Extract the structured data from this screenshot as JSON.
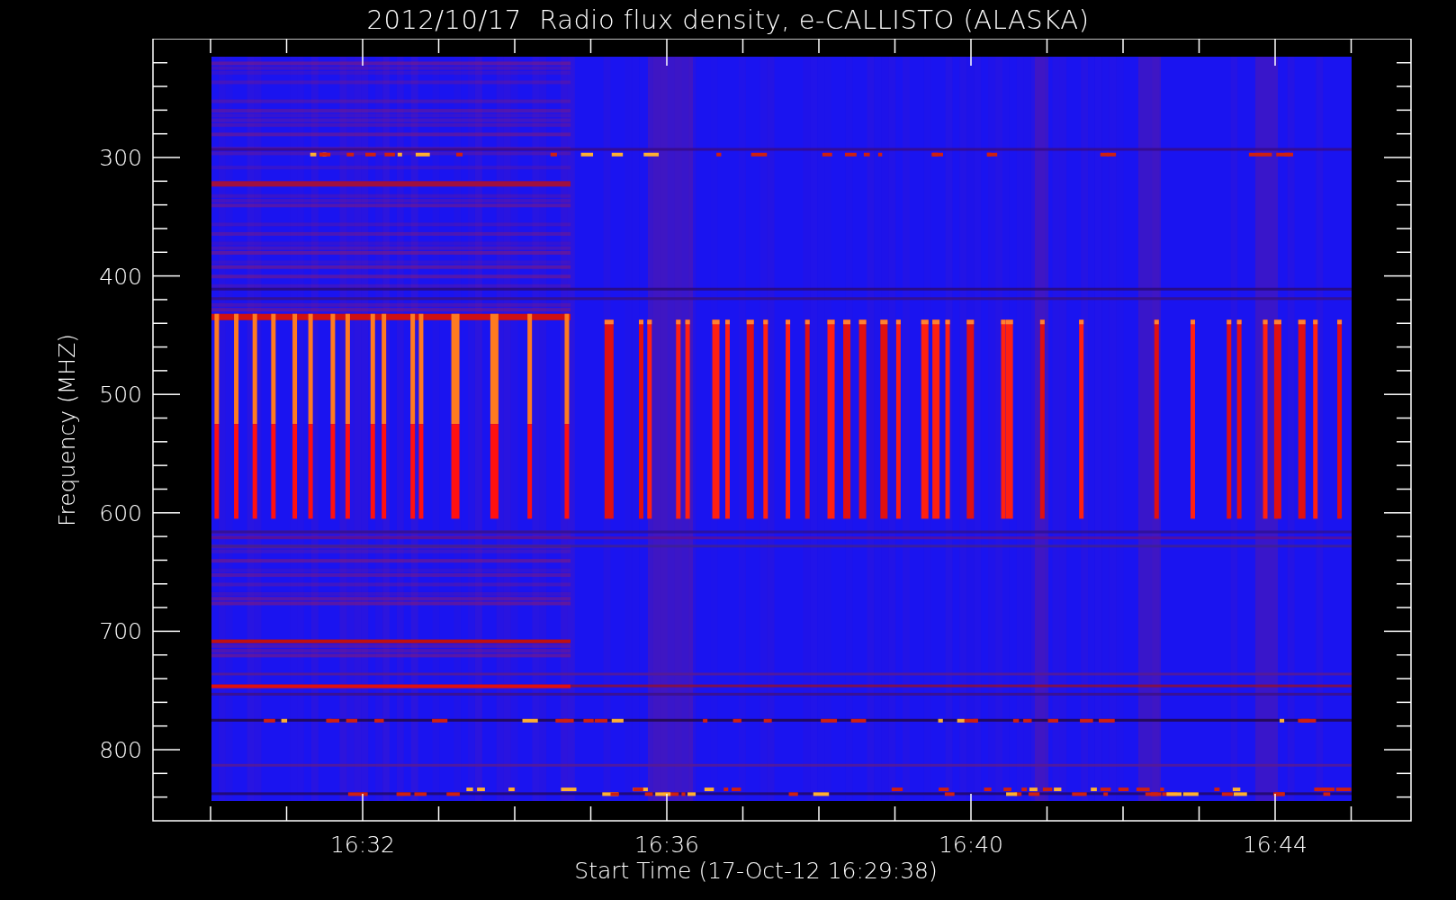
{
  "title": "2012/10/17  Radio flux density, e-CALLISTO (ALASKA)",
  "y_axis": {
    "label": "Frequency (MHZ)",
    "ticks": [
      "300",
      "400",
      "500",
      "600",
      "700",
      "800"
    ]
  },
  "x_axis": {
    "label": "Start Time (17-Oct-12 16:29:38)",
    "ticks": [
      "16:32",
      "16:36",
      "16:40",
      "16:44"
    ]
  }
}
